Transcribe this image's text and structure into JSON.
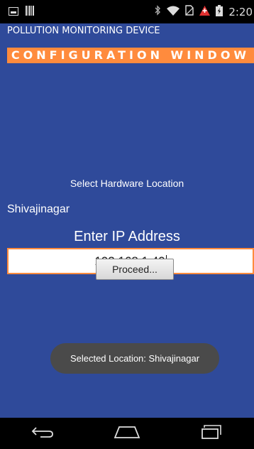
{
  "status_bar": {
    "time": "2:20",
    "icons": [
      "screenshot-icon",
      "barcode-icon",
      "bluetooth-icon",
      "wifi-icon",
      "no-sim-icon",
      "alert-icon",
      "battery-charging-icon"
    ]
  },
  "title_bar": {
    "title": "POLLUTION MONITORING DEVICE"
  },
  "main": {
    "banner": "CONFIGURATION WINDOW",
    "select_label": "Select Hardware Location",
    "selected_location": "Shivajinagar",
    "ip_label": "Enter IP Address",
    "ip_value": "192.168.1.40",
    "proceed_label": "Proceed..."
  },
  "toast": {
    "text": "Selected Location: Shivajinagar"
  },
  "nav_bar": {
    "icons": [
      "back-icon",
      "home-icon",
      "recents-icon"
    ]
  },
  "colors": {
    "primary": "#2f4a9a",
    "accent": "#ff8b3d",
    "toast_bg": "#4a4a4a"
  }
}
